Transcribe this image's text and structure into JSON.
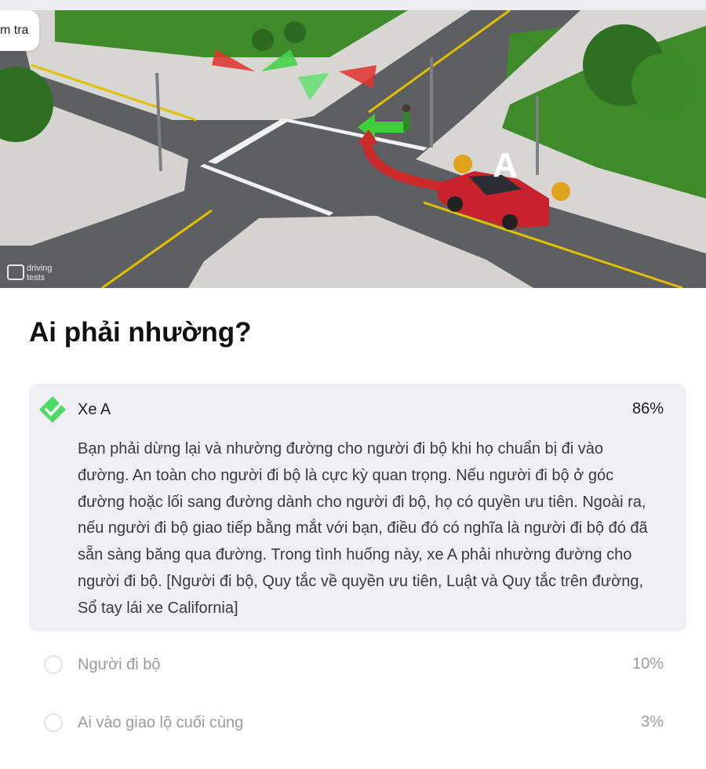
{
  "header": {
    "back_label": "m tra"
  },
  "scene": {
    "car_label": "A",
    "watermark_line1": "driving",
    "watermark_line2": "tests"
  },
  "question": {
    "title": "Ai phải nhường?"
  },
  "answers": [
    {
      "label": "Xe A",
      "percent": "86%",
      "selected": true,
      "correct": true,
      "explanation": "Bạn phải dừng lại và nhường đường cho người đi bộ khi họ chuẩn bị đi vào đường. An toàn cho người đi bộ là cực kỳ quan trọng. Nếu người đi bộ ở góc đường hoặc lối sang đường dành cho người đi bộ, họ có quyền ưu tiên. Ngoài ra, nếu người đi bộ giao tiếp bằng mắt với bạn, điều đó có nghĩa là người đi bộ đó đã sẵn sàng băng qua đường. Trong tình huống này, xe A phải nhường đường cho người đi bộ. [Người đi bộ, Quy tắc về quyền ưu tiên, Luật và Quy tắc trên đường, Sổ tay lái xe California]"
    },
    {
      "label": "Người đi bộ",
      "percent": "10%",
      "selected": false
    },
    {
      "label": "Ai vào giao lộ cuối cùng",
      "percent": "3%",
      "selected": false
    }
  ],
  "colors": {
    "correct_green": "#4cd964",
    "selected_bg": "#f0f0f4",
    "muted_text": "#9a9aa2",
    "car_red": "#c8232c",
    "grass": "#3f8a2a",
    "road": "#5d5f63"
  }
}
